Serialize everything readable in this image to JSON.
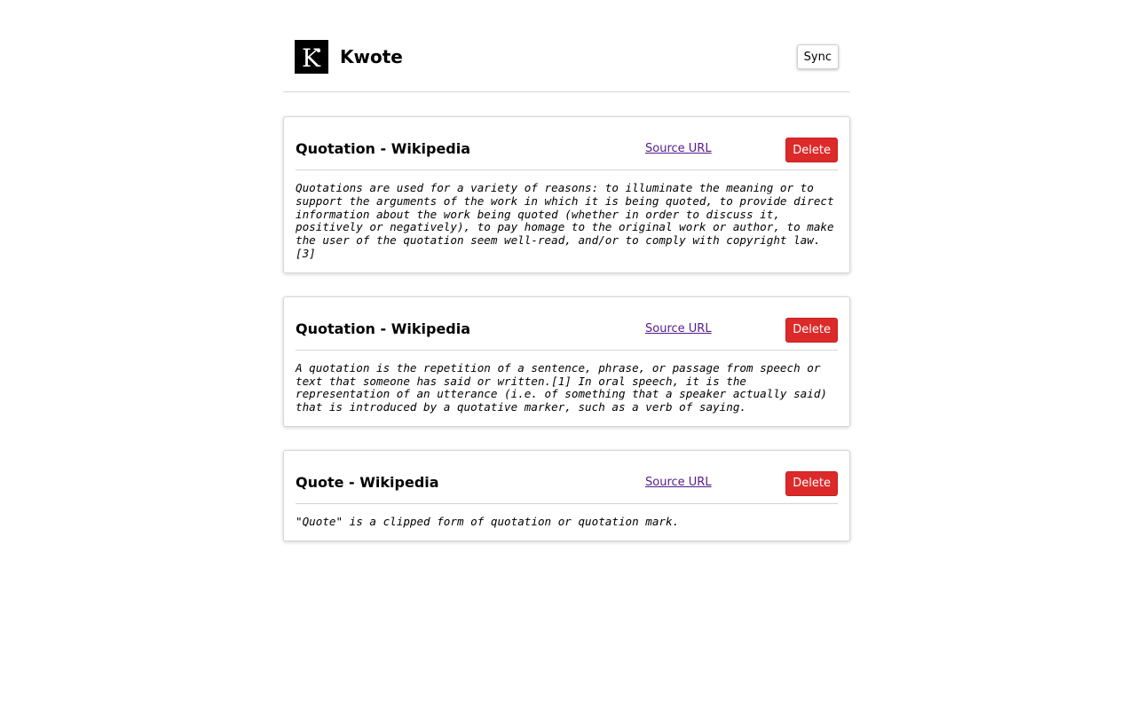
{
  "header": {
    "app_title": "Kwote",
    "sync_label": "Sync",
    "logo_letter": "K"
  },
  "quotes": [
    {
      "title": "Quotation - Wikipedia",
      "source_label": "Source URL",
      "delete_label": "Delete",
      "text": "Quotations are used for a variety of reasons: to illuminate the meaning or to support the arguments of the work in which it is being quoted, to provide direct information about the work being quoted (whether in order to discuss it, positively or negatively), to pay homage to the original work or author, to make the user of the quotation seem well-read, and/or to comply with copyright law.[3]"
    },
    {
      "title": "Quotation - Wikipedia",
      "source_label": "Source URL",
      "delete_label": "Delete",
      "text": "A quotation is the repetition of a sentence, phrase, or passage from speech or text that someone has said or written.[1] In oral speech, it is the representation of an utterance (i.e. of something that a speaker actually said) that is introduced by a quotative marker, such as a verb of saying."
    },
    {
      "title": "Quote - Wikipedia",
      "source_label": "Source URL",
      "delete_label": "Delete",
      "text": "\"Quote\" is a clipped form of quotation or quotation mark."
    }
  ],
  "colors": {
    "delete_bg": "#dc2a2a",
    "link": "#551a8b",
    "logo_bg": "#000000"
  }
}
